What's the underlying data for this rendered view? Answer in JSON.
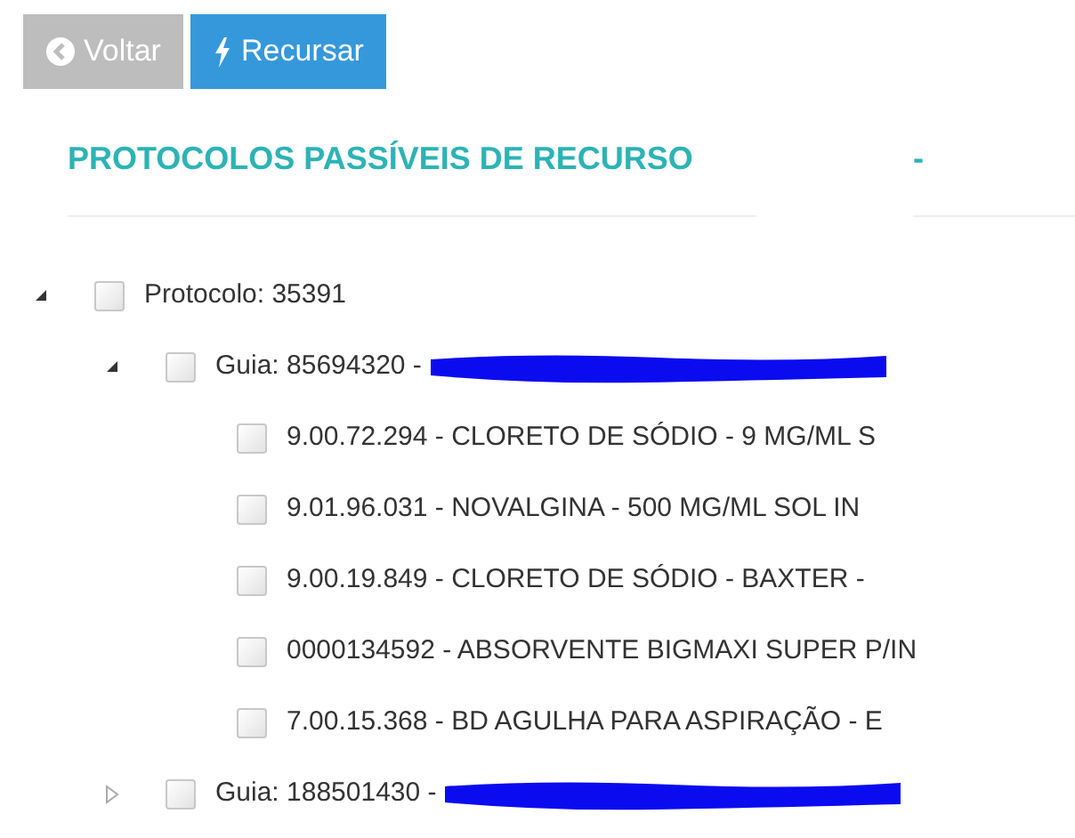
{
  "toolbar": {
    "buttons": [
      {
        "label": "Voltar",
        "kind": "back"
      },
      {
        "label": "Recursar",
        "kind": "primary"
      }
    ]
  },
  "section": {
    "title": "PROTOCOLOS PASSÍVEIS DE RECURSO",
    "aside": "-"
  },
  "tree": [
    {
      "label": "Protocolo: 35391",
      "checked": false,
      "expanded": true,
      "redacted": false,
      "children": [
        {
          "label": "Guia: 85694320 -",
          "checked": false,
          "expanded": true,
          "redacted": true,
          "children": [
            {
              "label": "9.00.72.294 - CLORETO DE SÓDIO - 9 MG/ML S",
              "checked": false
            },
            {
              "label": "9.01.96.031 - NOVALGINA - 500 MG/ML SOL IN",
              "checked": false
            },
            {
              "label": "9.00.19.849 - CLORETO DE SÓDIO - BAXTER -",
              "checked": false
            },
            {
              "label": "0000134592 - ABSORVENTE BIGMAXI SUPER P/IN",
              "checked": false
            },
            {
              "label": "7.00.15.368 - BD AGULHA PARA ASPIRAÇÃO - E",
              "checked": false
            }
          ]
        },
        {
          "label": "Guia: 188501430 -",
          "checked": false,
          "expanded": false,
          "redacted": true
        }
      ]
    }
  ]
}
